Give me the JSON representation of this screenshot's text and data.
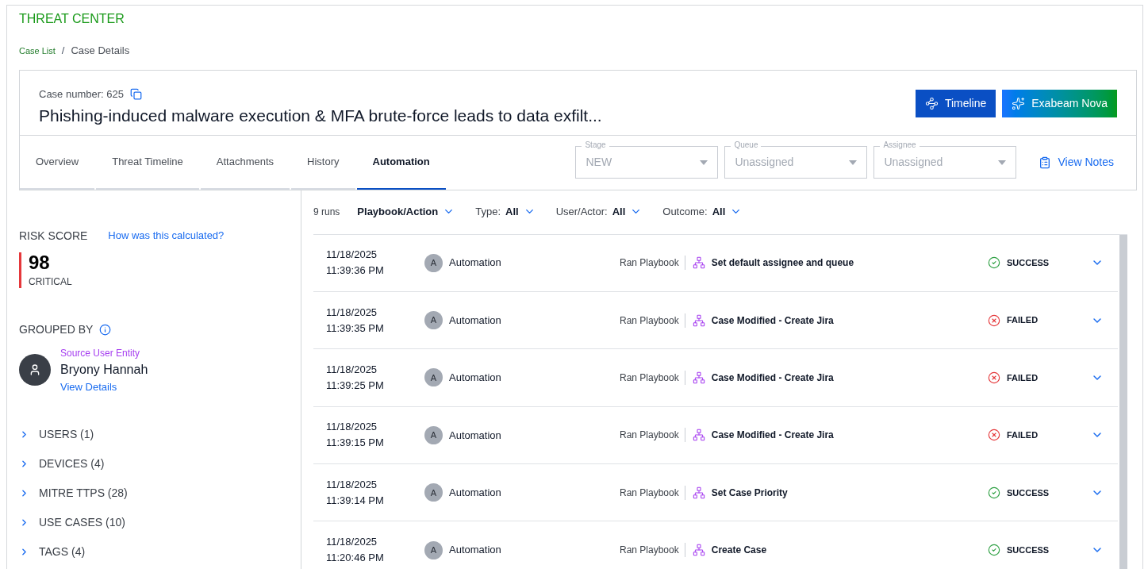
{
  "app_title": "THREAT CENTER",
  "breadcrumb": [
    {
      "label": "Case List",
      "link": true
    },
    {
      "label": "Case Details",
      "link": false
    }
  ],
  "breadcrumb_separator": "/",
  "case": {
    "number_label": "Case number: 625",
    "title": "Phishing-induced malware execution & MFA brute-force leads to data exfilt...",
    "buttons": [
      {
        "label": "Timeline",
        "kind": "timeline"
      },
      {
        "label": "Exabeam Nova",
        "kind": "nova"
      }
    ]
  },
  "tabs": [
    {
      "label": "Overview",
      "selected": false
    },
    {
      "label": "Threat Timeline",
      "selected": false
    },
    {
      "label": "Attachments",
      "selected": false
    },
    {
      "label": "History",
      "selected": false
    },
    {
      "label": "Automation",
      "selected": true
    }
  ],
  "selects": [
    {
      "label": "Stage",
      "value": "NEW",
      "disabled": true
    },
    {
      "label": "Queue",
      "value": "Unassigned",
      "disabled": true
    },
    {
      "label": "Assignee",
      "value": "Unassigned",
      "disabled": true
    }
  ],
  "view_notes": "View Notes",
  "sidebar": {
    "risk_label": "RISK SCORE",
    "risk_link": "How was this calculated?",
    "score": "98",
    "severity": "CRITICAL",
    "grouped_by": "GROUPED BY",
    "entity_type": "Source User Entity",
    "entity_name": "Bryony Hannah",
    "entity_link": "View Details",
    "sections": [
      {
        "label": "USERS (1)",
        "expanded": false
      },
      {
        "label": "DEVICES (4)",
        "expanded": false
      },
      {
        "label": "MITRE TTPS (28)",
        "expanded": false
      },
      {
        "label": "USE CASES (10)",
        "expanded": false
      },
      {
        "label": "TAGS (4)",
        "expanded": false
      }
    ]
  },
  "filters": {
    "count": "9 runs",
    "items": [
      {
        "label": "Playbook/Action"
      },
      {
        "label": "Type:",
        "value": "All"
      },
      {
        "label": "User/Actor:",
        "value": "All"
      },
      {
        "label": "Outcome:",
        "value": "All"
      }
    ]
  },
  "runs": [
    {
      "date": "11/18/2025",
      "time": "11:39:36 PM",
      "avatar": "A",
      "actor": "Automation",
      "action": "Ran Playbook",
      "playbook": "Set default assignee and queue",
      "outcome": "SUCCESS",
      "kind": "success",
      "expanded": false
    },
    {
      "date": "11/18/2025",
      "time": "11:39:35 PM",
      "avatar": "A",
      "actor": "Automation",
      "action": "Ran Playbook",
      "playbook": "Case Modified - Create Jira",
      "outcome": "FAILED",
      "kind": "failed",
      "expanded": false
    },
    {
      "date": "11/18/2025",
      "time": "11:39:25 PM",
      "avatar": "A",
      "actor": "Automation",
      "action": "Ran Playbook",
      "playbook": "Case Modified - Create Jira",
      "outcome": "FAILED",
      "kind": "failed",
      "expanded": false
    },
    {
      "date": "11/18/2025",
      "time": "11:39:15 PM",
      "avatar": "A",
      "actor": "Automation",
      "action": "Ran Playbook",
      "playbook": "Case Modified - Create Jira",
      "outcome": "FAILED",
      "kind": "failed",
      "expanded": false
    },
    {
      "date": "11/18/2025",
      "time": "11:39:14 PM",
      "avatar": "A",
      "actor": "Automation",
      "action": "Ran Playbook",
      "playbook": "Set Case Priority",
      "outcome": "SUCCESS",
      "kind": "success",
      "expanded": false
    },
    {
      "date": "11/18/2025",
      "time": "11:20:46 PM",
      "avatar": "A",
      "actor": "Automation",
      "action": "Ran Playbook",
      "playbook": "Create Case",
      "outcome": "SUCCESS",
      "kind": "success",
      "expanded": false
    }
  ]
}
